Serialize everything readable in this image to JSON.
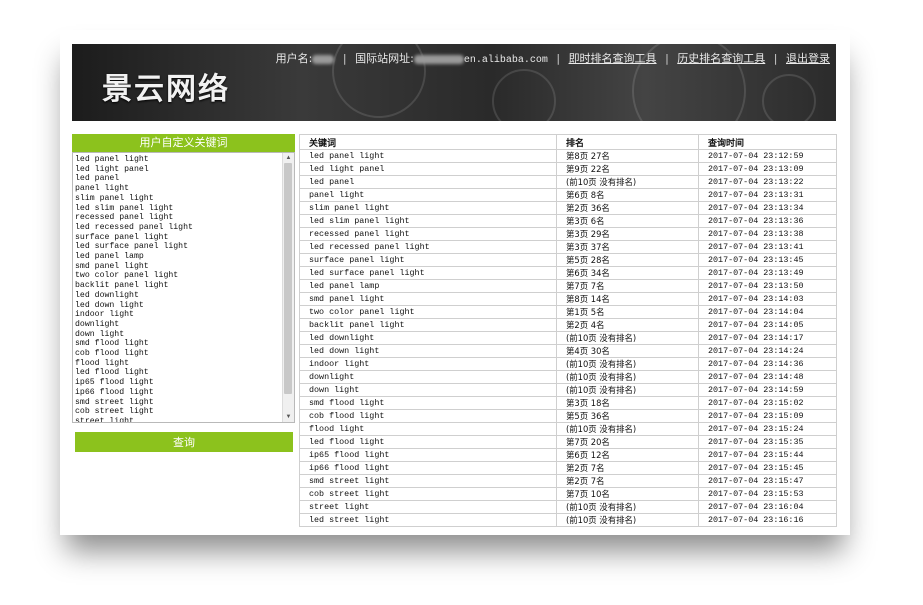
{
  "header": {
    "logo": "景云网络",
    "username_label": "用户名:",
    "site_label": "国际站网址:",
    "site_suffix": "en.alibaba.com",
    "links": [
      "即时排名查询工具",
      "历史排名查询工具",
      "退出登录"
    ]
  },
  "sidebar": {
    "title": "用户自定义关键词",
    "keywords_text": "led panel light\nled light panel\nled panel\npanel light\nslim panel light\nled slim panel light\nrecessed panel light\nled recessed panel light\nsurface panel light\nled surface panel light\nled panel lamp\nsmd panel light\ntwo color panel light\nbacklit panel light\nled downlight\nled down light\nindoor light\ndownlight\ndown light\nsmd flood light\ncob flood light\nflood light\nled flood light\nip65 flood light\nip66 flood light\nsmd street light\ncob street light\nstreet light",
    "query_button": "查询"
  },
  "table": {
    "headers": [
      "关键词",
      "排名",
      "查询时间"
    ],
    "rows": [
      [
        "led panel light",
        "第8页 27名",
        "2017-07-04 23:12:59"
      ],
      [
        "led light panel",
        "第9页 22名",
        "2017-07-04 23:13:09"
      ],
      [
        "led panel",
        "(前10页 没有排名)",
        "2017-07-04 23:13:22"
      ],
      [
        "panel light",
        "第6页 8名",
        "2017-07-04 23:13:31"
      ],
      [
        "slim panel light",
        "第2页 36名",
        "2017-07-04 23:13:34"
      ],
      [
        "led slim panel light",
        "第3页 6名",
        "2017-07-04 23:13:36"
      ],
      [
        "recessed panel light",
        "第3页 29名",
        "2017-07-04 23:13:38"
      ],
      [
        "led recessed panel light",
        "第3页 37名",
        "2017-07-04 23:13:41"
      ],
      [
        "surface panel light",
        "第5页 28名",
        "2017-07-04 23:13:45"
      ],
      [
        "led surface panel light",
        "第6页 34名",
        "2017-07-04 23:13:49"
      ],
      [
        "led panel lamp",
        "第7页 7名",
        "2017-07-04 23:13:50"
      ],
      [
        "smd panel light",
        "第8页 14名",
        "2017-07-04 23:14:03"
      ],
      [
        "two color panel light",
        "第1页 5名",
        "2017-07-04 23:14:04"
      ],
      [
        "backlit panel light",
        "第2页 4名",
        "2017-07-04 23:14:05"
      ],
      [
        "led downlight",
        "(前10页 没有排名)",
        "2017-07-04 23:14:17"
      ],
      [
        "led down light",
        "第4页 30名",
        "2017-07-04 23:14:24"
      ],
      [
        "indoor light",
        "(前10页 没有排名)",
        "2017-07-04 23:14:36"
      ],
      [
        "downlight",
        "(前10页 没有排名)",
        "2017-07-04 23:14:48"
      ],
      [
        "down light",
        "(前10页 没有排名)",
        "2017-07-04 23:14:59"
      ],
      [
        "smd flood light",
        "第3页 18名",
        "2017-07-04 23:15:02"
      ],
      [
        "cob flood light",
        "第5页 36名",
        "2017-07-04 23:15:09"
      ],
      [
        "flood light",
        "(前10页 没有排名)",
        "2017-07-04 23:15:24"
      ],
      [
        "led flood light",
        "第7页 20名",
        "2017-07-04 23:15:35"
      ],
      [
        "ip65 flood light",
        "第6页 12名",
        "2017-07-04 23:15:44"
      ],
      [
        "ip66 flood light",
        "第2页 7名",
        "2017-07-04 23:15:45"
      ],
      [
        "smd street light",
        "第2页 7名",
        "2017-07-04 23:15:47"
      ],
      [
        "cob street light",
        "第7页 10名",
        "2017-07-04 23:15:53"
      ],
      [
        "street light",
        "(前10页 没有排名)",
        "2017-07-04 23:16:04"
      ],
      [
        "led street light",
        "(前10页 没有排名)",
        "2017-07-04 23:16:16"
      ]
    ]
  },
  "colors": {
    "accent": "#8cc21d",
    "header_bg": "#2e2e2e"
  }
}
